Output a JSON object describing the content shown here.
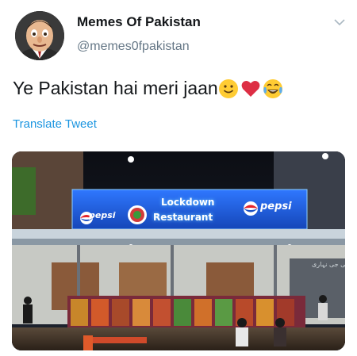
{
  "tweet": {
    "display_name": "Memes Of Pakistan",
    "handle": "@memes0fpakistan",
    "text": "Ye Pakistan hai meri jaan",
    "emojis": [
      "slightly-smiling-face",
      "red-heart",
      "face-with-tears-of-joy"
    ],
    "translate_label": "Translate Tweet"
  },
  "media": {
    "sign": {
      "line1": "Lockdown",
      "line2": "Restaurant",
      "brand_left": "pepsi",
      "brand_right": "pepsi",
      "urdu_text": "علی جی نہاری"
    }
  },
  "colors": {
    "link": "#1b95e0",
    "secondary_text": "#657786",
    "sign_blue": "#1f5fd6"
  }
}
